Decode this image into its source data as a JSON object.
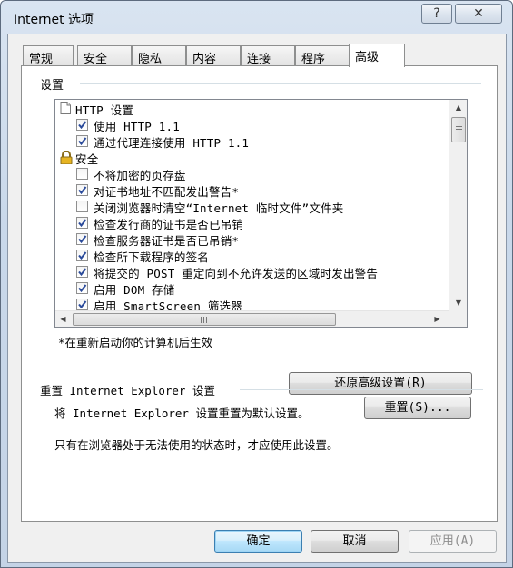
{
  "window": {
    "title": "Internet 选项",
    "help_glyph": "?",
    "close_glyph": "✕"
  },
  "tabs": [
    {
      "label": "常规",
      "active": false
    },
    {
      "label": "安全",
      "active": false
    },
    {
      "label": "隐私",
      "active": false
    },
    {
      "label": "内容",
      "active": false
    },
    {
      "label": "连接",
      "active": false
    },
    {
      "label": "程序",
      "active": false
    },
    {
      "label": "高级",
      "active": true
    }
  ],
  "settings": {
    "group_label": "设置",
    "items": [
      {
        "kind": "category",
        "icon": "page-icon",
        "label": "HTTP 设置"
      },
      {
        "kind": "checkbox",
        "checked": true,
        "label": "使用 HTTP 1.1"
      },
      {
        "kind": "checkbox",
        "checked": true,
        "label": "通过代理连接使用 HTTP 1.1"
      },
      {
        "kind": "category",
        "icon": "lock-icon",
        "label": "安全"
      },
      {
        "kind": "checkbox",
        "checked": false,
        "label": "不将加密的页存盘"
      },
      {
        "kind": "checkbox",
        "checked": true,
        "label": "对证书地址不匹配发出警告*"
      },
      {
        "kind": "checkbox",
        "checked": false,
        "label": "关闭浏览器时清空“Internet 临时文件”文件夹"
      },
      {
        "kind": "checkbox",
        "checked": true,
        "label": "检查发行商的证书是否已吊销"
      },
      {
        "kind": "checkbox",
        "checked": true,
        "label": "检查服务器证书是否已吊销*"
      },
      {
        "kind": "checkbox",
        "checked": true,
        "label": "检查所下载程序的签名"
      },
      {
        "kind": "checkbox",
        "checked": true,
        "label": "将提交的 POST 重定向到不允许发送的区域时发出警告"
      },
      {
        "kind": "checkbox",
        "checked": true,
        "label": "启用 DOM 存储"
      },
      {
        "kind": "checkbox",
        "checked": true,
        "label": "启用 SmartScreen 筛选器"
      }
    ],
    "restart_note": "*在重新启动你的计算机后生效",
    "restore_button": "还原高级设置(R)"
  },
  "reset": {
    "group_label": "重置 Internet Explorer 设置",
    "description": "将 Internet Explorer 设置重置为默认设置。",
    "button": "重置(S)...",
    "warning": "只有在浏览器处于无法使用的状态时，才应使用此设置。"
  },
  "footer": {
    "ok": "确定",
    "cancel": "取消",
    "apply": "应用(A)"
  },
  "colors": {
    "accent": "#3c7fb1",
    "check": "#2a4a9a",
    "disabled_text": "#8d8d8d"
  }
}
